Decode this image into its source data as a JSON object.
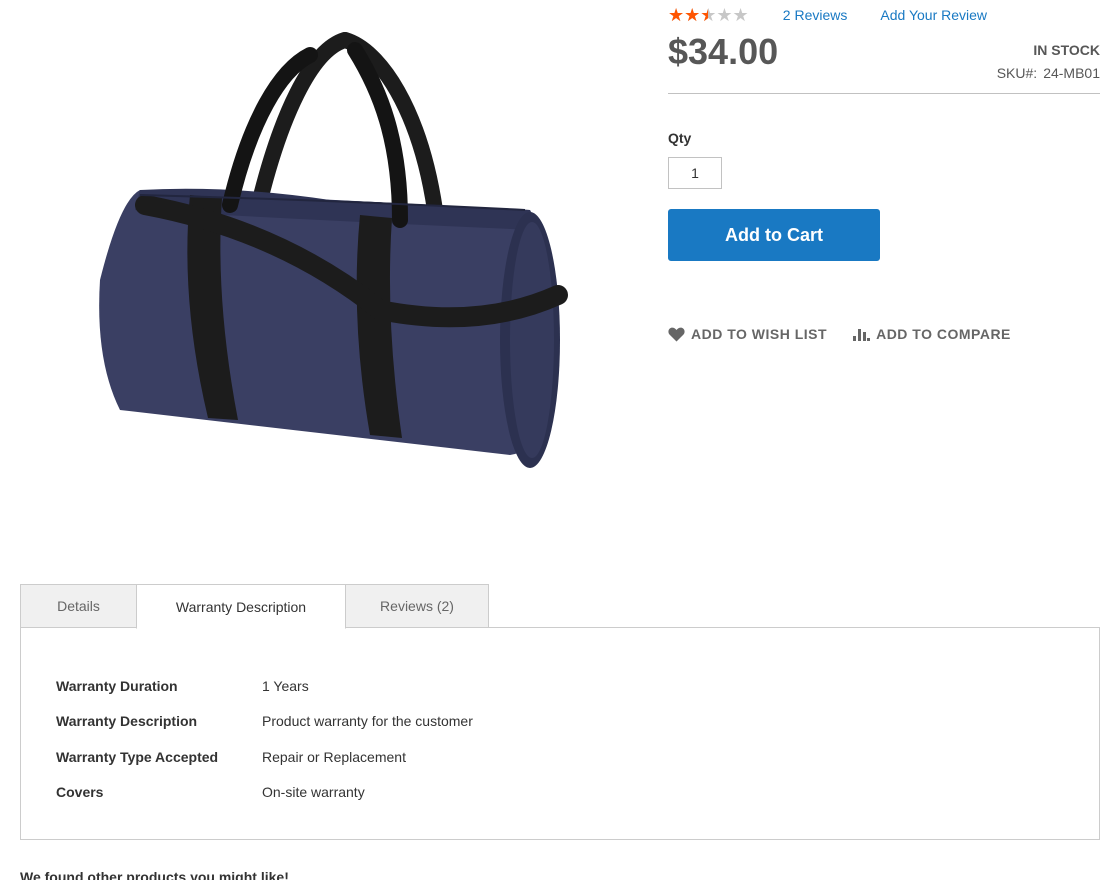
{
  "product": {
    "rating_fraction": 0.5,
    "reviews_count": "2",
    "reviews_label": "Reviews",
    "add_review_label": "Add Your Review",
    "price": "$34.00",
    "stock_status": "In stock",
    "sku_label": "SKU#:",
    "sku_value": "24-MB01",
    "qty_label": "Qty",
    "qty_value": "1",
    "add_to_cart_label": "Add to Cart",
    "wishlist_label": "Add to Wish List",
    "compare_label": "Add to Compare",
    "image_icon": "duffle-bag-image"
  },
  "tabs": [
    {
      "label": "Details",
      "active": false
    },
    {
      "label": "Warranty Description",
      "active": true
    },
    {
      "label": "Reviews (2)",
      "active": false
    }
  ],
  "warranty": [
    {
      "label": "Warranty Duration",
      "value": "1 Years"
    },
    {
      "label": "Warranty Description",
      "value": "Product warranty for the customer"
    },
    {
      "label": "Warranty Type Accepted",
      "value": "Repair or Replacement"
    },
    {
      "label": "Covers",
      "value": "On-site warranty"
    }
  ],
  "related": {
    "title": "We found other products you might like!"
  },
  "colors": {
    "accent": "#1979c3",
    "star_filled": "#ff5501",
    "star_empty": "#c7c7c7",
    "bag_body": "#3a3f63",
    "bag_strap": "#1c1c1c"
  }
}
